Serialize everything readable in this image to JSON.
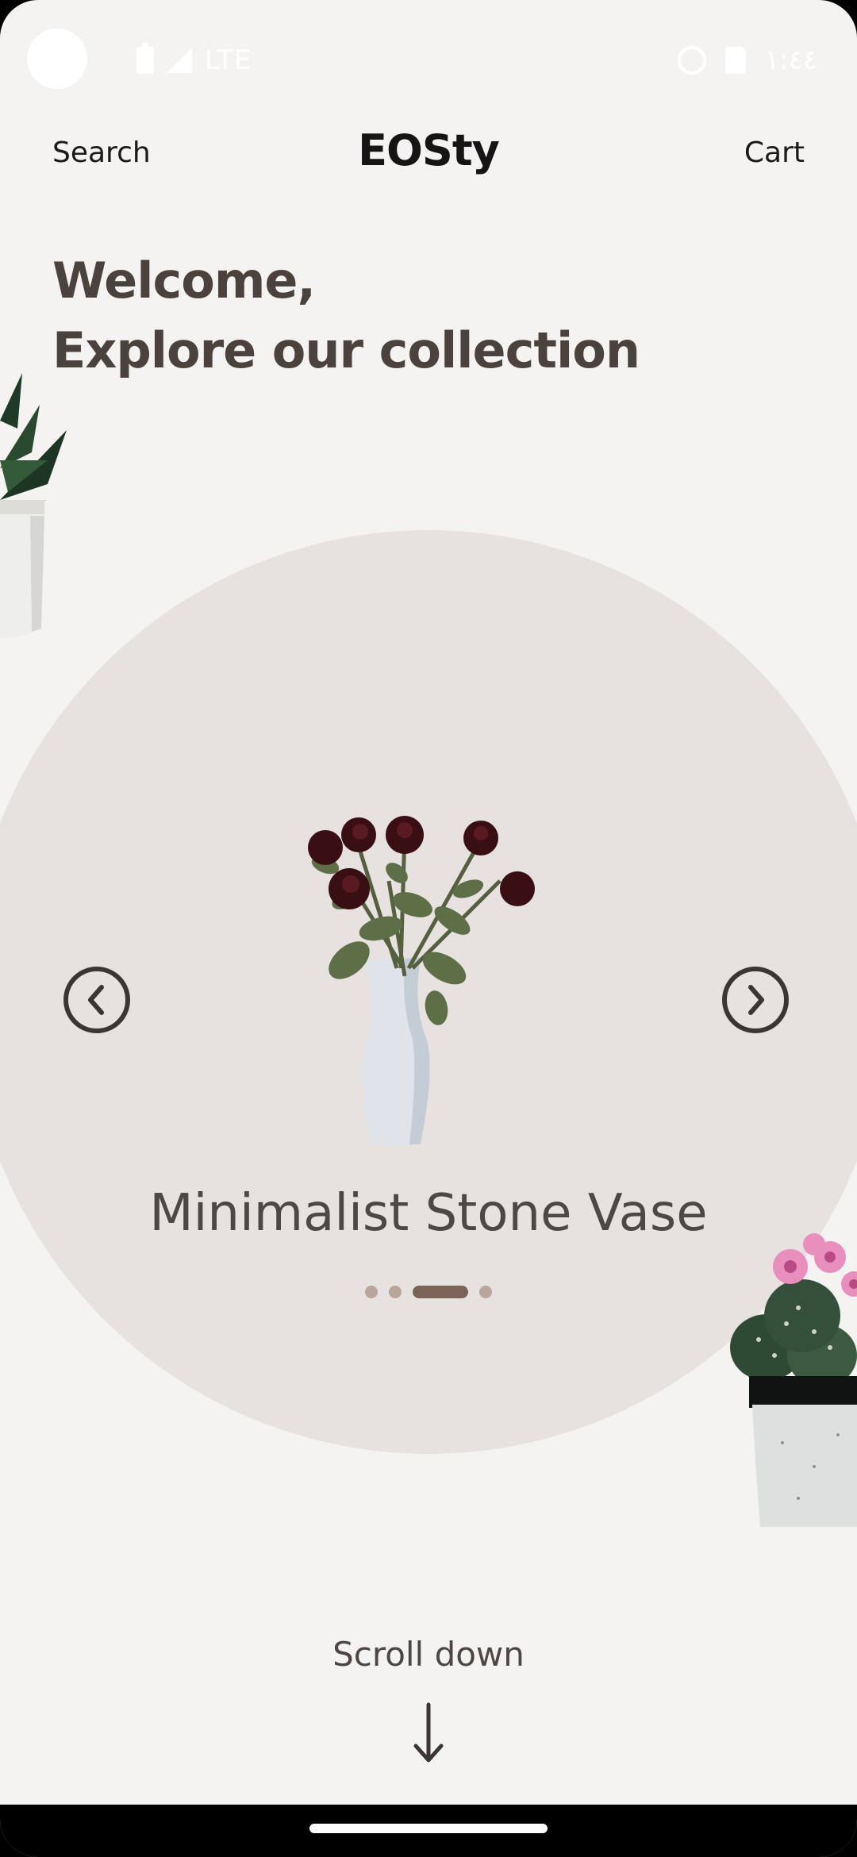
{
  "status_bar": {
    "network": "LTE",
    "time": "١:٤٤"
  },
  "header": {
    "search_label": "Search",
    "brand": "EOSty",
    "cart_label": "Cart"
  },
  "welcome": {
    "line1": "Welcome,",
    "line2": "Explore our collection"
  },
  "carousel": {
    "product_name": "Minimalist Stone Vase",
    "dot_count": 4,
    "active_index": 2,
    "icons": {
      "prev": "chevron-left-icon",
      "next": "chevron-right-icon"
    }
  },
  "footer": {
    "scroll_label": "Scroll down",
    "scroll_icon": "arrow-down-icon"
  },
  "colors": {
    "background": "#f5f3f1",
    "circle": "#e7e2df",
    "heading": "#4b423d",
    "active_dot": "#7c6357",
    "inactive_dot": "#b8a59b"
  }
}
